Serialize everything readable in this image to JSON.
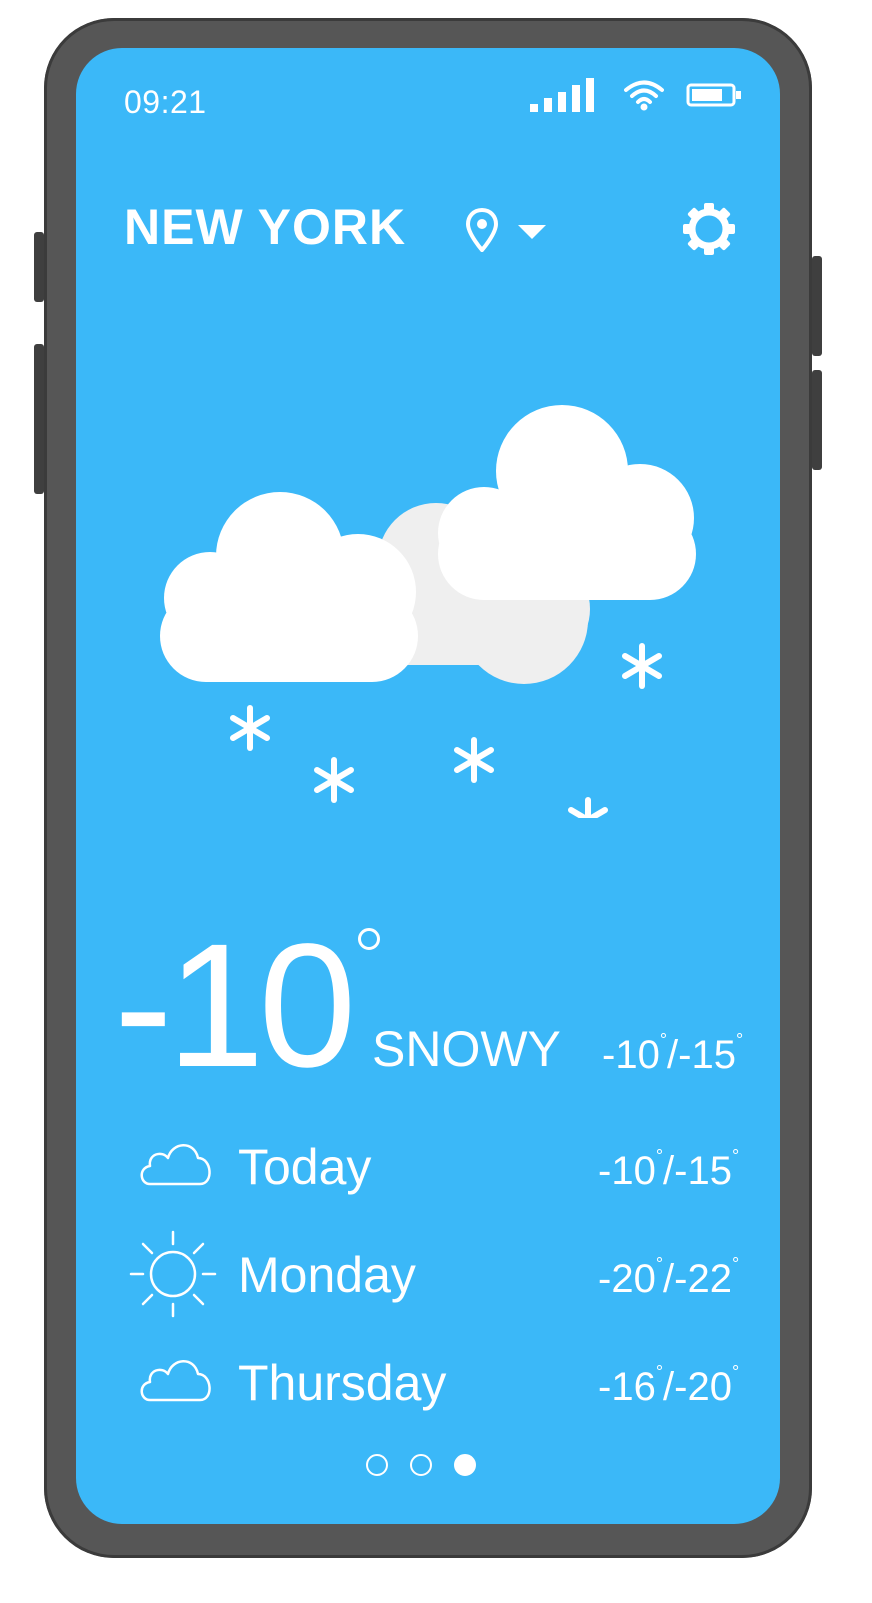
{
  "status_bar": {
    "time": "09:21",
    "signal_icon": "signal-bars-icon",
    "wifi_icon": "wifi-icon",
    "battery_icon": "battery-icon"
  },
  "header": {
    "city": "NEW YORK",
    "location_icon": "location-pin-icon",
    "dropdown_icon": "chevron-down-icon",
    "settings_icon": "gear-icon"
  },
  "current": {
    "temperature": "-10",
    "condition": "SNOWY",
    "range_high": "-10",
    "range_low": "-15",
    "illustration_icon": "snowy-clouds-icon"
  },
  "forecast": [
    {
      "day": "Today",
      "icon": "cloud-icon",
      "high": "-10",
      "low": "-15"
    },
    {
      "day": "Monday",
      "icon": "sun-icon",
      "high": "-20",
      "low": "-22"
    },
    {
      "day": "Thursday",
      "icon": "cloud-icon",
      "high": "-16",
      "low": "-20"
    }
  ],
  "pagination": {
    "total_pages": 3,
    "active_page": 3
  },
  "colors": {
    "screen_background": "#3bb8f8",
    "phone_frame": "#565656",
    "text": "#ffffff"
  }
}
